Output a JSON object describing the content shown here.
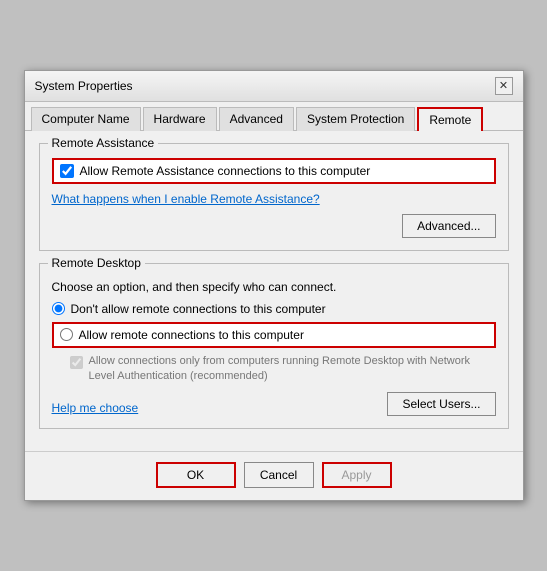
{
  "window": {
    "title": "System Properties",
    "close_label": "✕"
  },
  "tabs": {
    "items": [
      {
        "label": "Computer Name",
        "active": false
      },
      {
        "label": "Hardware",
        "active": false
      },
      {
        "label": "Advanced",
        "active": false
      },
      {
        "label": "System Protection",
        "active": false
      },
      {
        "label": "Remote",
        "active": true
      }
    ]
  },
  "remote_assistance": {
    "group_label": "Remote Assistance",
    "checkbox_label": "Allow Remote Assistance connections to this computer",
    "link_text": "What happens when I enable Remote Assistance?",
    "advanced_btn": "Advanced..."
  },
  "remote_desktop": {
    "group_label": "Remote Desktop",
    "desc": "Choose an option, and then specify who can connect.",
    "option1": "Don't allow remote connections to this computer",
    "option2": "Allow remote connections to this computer",
    "sub_checkbox_text": "Allow connections only from computers running Remote Desktop\nwith Network Level Authentication (recommended)",
    "help_link": "Help me choose",
    "select_users_btn": "Select Users..."
  },
  "footer": {
    "ok_label": "OK",
    "cancel_label": "Cancel",
    "apply_label": "Apply"
  }
}
